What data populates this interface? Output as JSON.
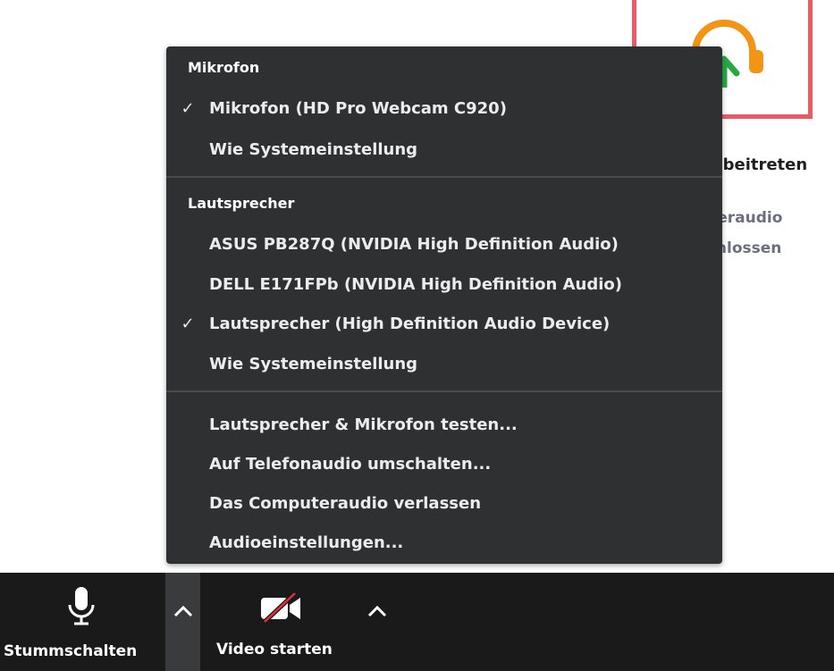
{
  "background": {
    "join_audio_label": "Dem Audio beitreten",
    "computer_audio_status_line1": "Computeraudio",
    "computer_audio_status_line2": "geschlossen",
    "headphone_icon": "headphones-join-icon",
    "tile_border_color": "#ec5a66"
  },
  "menu": {
    "microphone_section": {
      "heading": "Mikrofon",
      "items": [
        {
          "label": "Mikrofon (HD Pro Webcam C920)",
          "checked": true
        },
        {
          "label": "Wie Systemeinstellung",
          "checked": false
        }
      ]
    },
    "speaker_section": {
      "heading": "Lautsprecher",
      "items": [
        {
          "label": "ASUS PB287Q (NVIDIA High Definition Audio)",
          "checked": false
        },
        {
          "label": "DELL E171FPb (NVIDIA High Definition Audio)",
          "checked": false
        },
        {
          "label": "Lautsprecher (High Definition Audio Device)",
          "checked": true
        },
        {
          "label": "Wie Systemeinstellung",
          "checked": false
        }
      ]
    },
    "actions": [
      {
        "label": "Lautsprecher & Mikrofon testen..."
      },
      {
        "label": "Auf Telefonaudio umschalten..."
      },
      {
        "label": "Das Computeraudio verlassen"
      },
      {
        "label": "Audioeinstellungen..."
      }
    ],
    "check_glyph": "✓"
  },
  "toolbar": {
    "mute_label": "Stummschalten",
    "video_label": "Video starten",
    "mic_icon": "microphone-icon",
    "video_icon": "video-off-icon"
  }
}
